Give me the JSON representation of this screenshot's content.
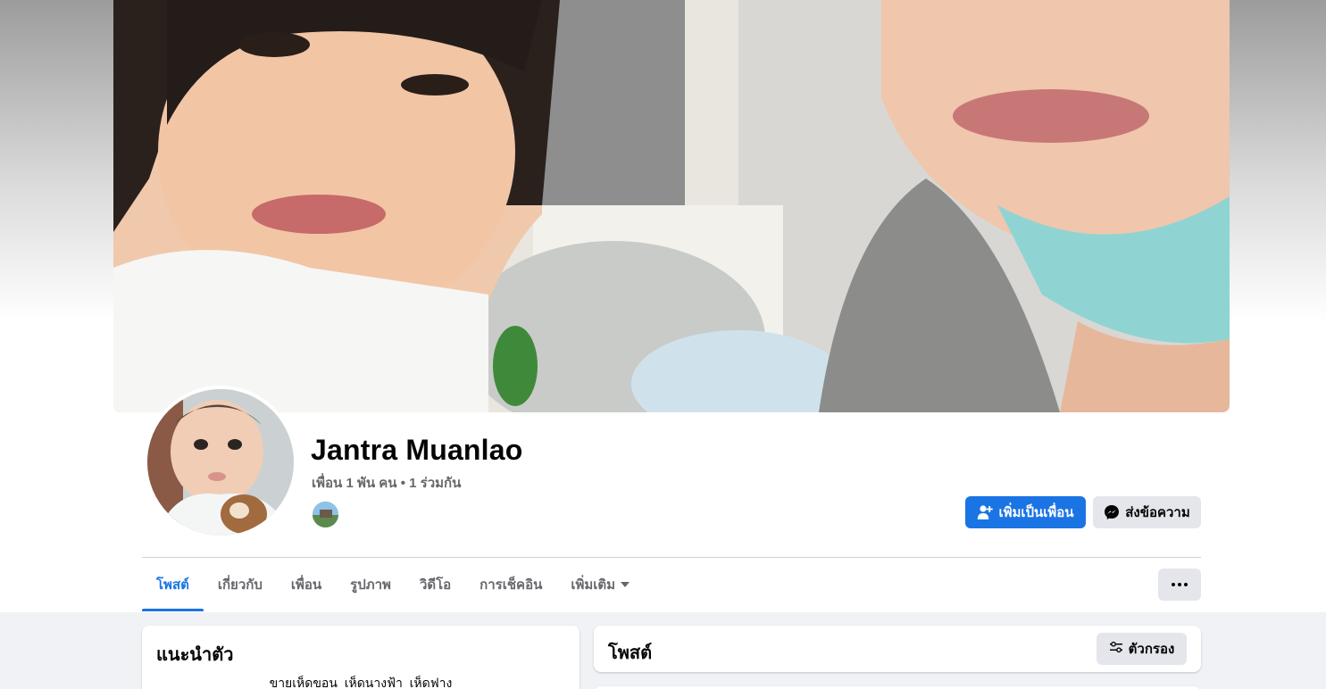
{
  "profile": {
    "name": "Jantra Muanlao",
    "friends_summary": "เพื่อน 1 พัน คน • 1 ร่วมกัน"
  },
  "actions": {
    "add_friend_label": "เพิ่มเป็นเพื่อน",
    "message_label": "ส่งข้อความ"
  },
  "tabs": [
    {
      "label": "โพสต์",
      "active": true
    },
    {
      "label": "เกี่ยวกับ",
      "active": false
    },
    {
      "label": "เพื่อน",
      "active": false
    },
    {
      "label": "รูปภาพ",
      "active": false
    },
    {
      "label": "วิดีโอ",
      "active": false
    },
    {
      "label": "การเช็คอิน",
      "active": false
    },
    {
      "label": "เพิ่มเติม",
      "active": false
    }
  ],
  "intro": {
    "title": "แนะนำตัว",
    "bio": "ขายเห็ดขอน_เห็ดนางฟ้า_เห็ดฟาง"
  },
  "posts": {
    "title": "โพสต์",
    "filter_label": "ตัวกรอง"
  },
  "colors": {
    "accent": "#1b74e4",
    "background": "#f0f2f5",
    "secondary_button": "#e4e6eb",
    "muted_text": "#65676b"
  },
  "icons": {
    "add_friend": "person-plus-icon",
    "message": "messenger-icon",
    "more": "ellipsis-icon",
    "filter": "sliders-icon",
    "dropdown": "caret-down-icon"
  }
}
